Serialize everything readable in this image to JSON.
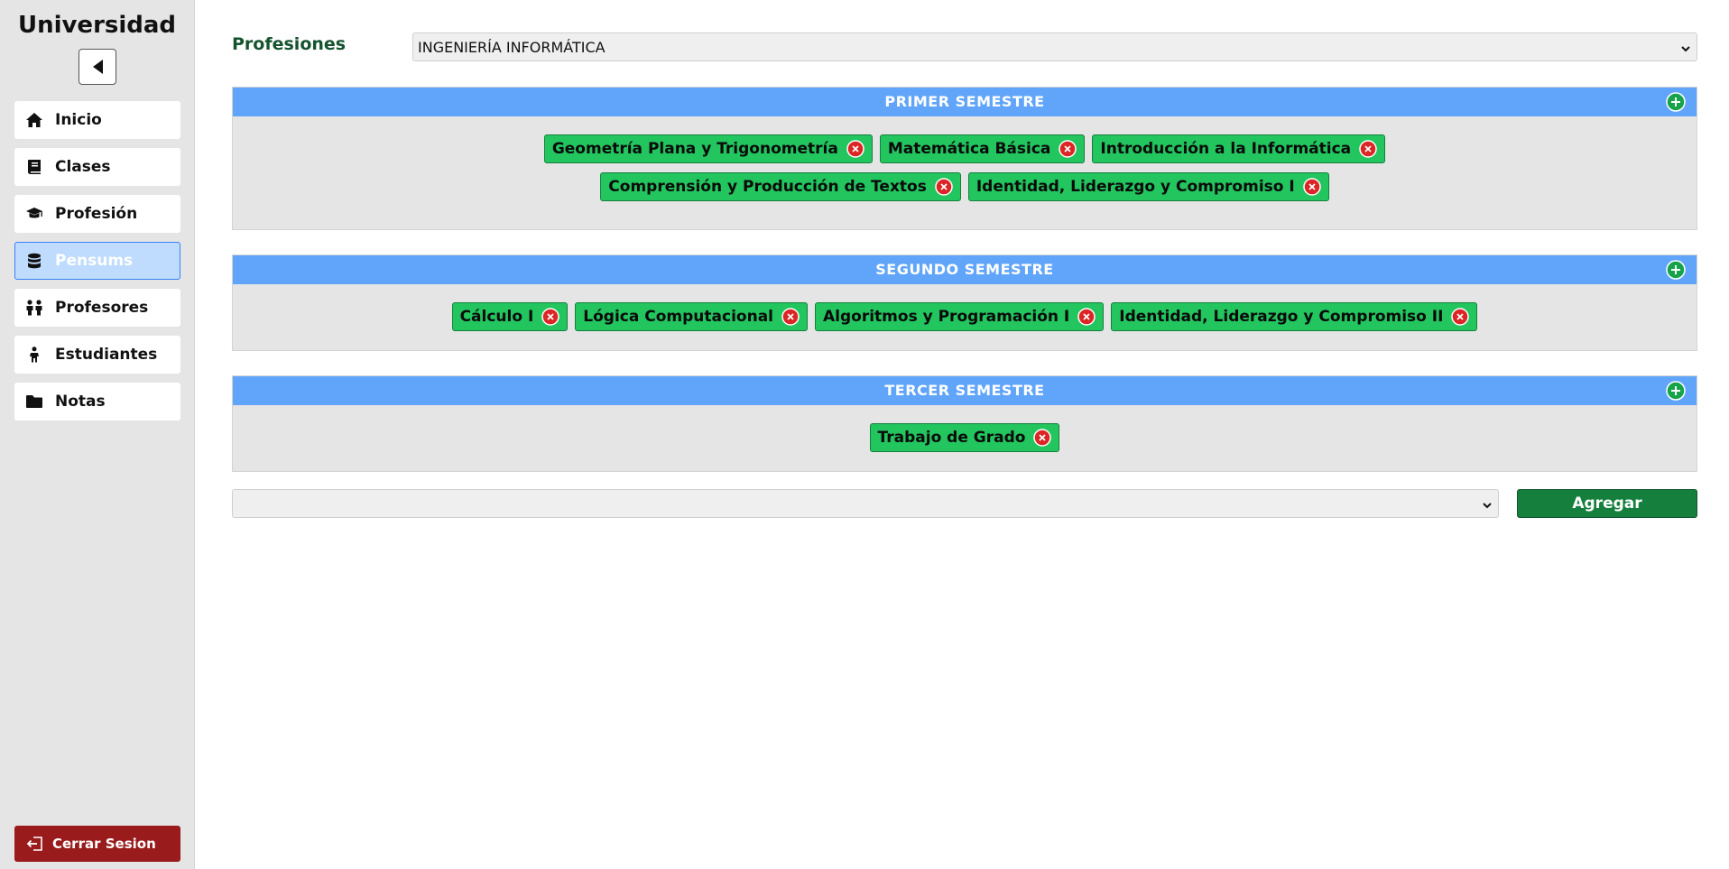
{
  "sidebar": {
    "brand": "Universidad",
    "back_icon": "back-arrow-icon",
    "items": [
      {
        "label": "Inicio",
        "icon": "home-icon",
        "active": false
      },
      {
        "label": "Clases",
        "icon": "book-icon",
        "active": false
      },
      {
        "label": "Profesión",
        "icon": "graduation-cap-icon",
        "active": false
      },
      {
        "label": "Pensums",
        "icon": "database-icon",
        "active": true
      },
      {
        "label": "Profesores",
        "icon": "people-icon",
        "active": false
      },
      {
        "label": "Estudiantes",
        "icon": "person-icon",
        "active": false
      },
      {
        "label": "Notas",
        "icon": "folder-icon",
        "active": false
      }
    ],
    "logout_label": "Cerrar Sesion"
  },
  "main": {
    "profession_label": "Profesiones",
    "profession_selected": "INGENIERÍA INFORMÁTICA",
    "semesters": [
      {
        "title": "PRIMER SEMESTRE",
        "courses": [
          "Geometría Plana y Trigonometría",
          "Matemática Básica",
          "Introducción a la Informática",
          "Comprensión y Producción de Textos",
          "Identidad, Liderazgo y Compromiso I"
        ]
      },
      {
        "title": "SEGUNDO SEMESTRE",
        "courses": [
          "Cálculo I",
          "Lógica Computacional",
          "Algoritmos y Programación I",
          "Identidad, Liderazgo y Compromiso II"
        ]
      },
      {
        "title": "TERCER SEMESTRE",
        "courses": [
          "Trabajo de Grado"
        ]
      }
    ],
    "add_select_value": "",
    "add_button_label": "Agregar"
  },
  "colors": {
    "semester_header": "#60a5fa",
    "chip": "#22c55e",
    "agregar": "#15803d",
    "logout": "#991b1b",
    "remove_icon": "#dc2626",
    "add_icon": "#16a34a"
  }
}
